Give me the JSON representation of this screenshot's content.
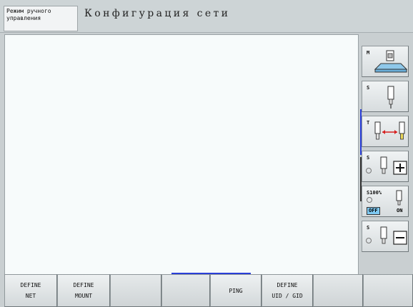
{
  "header": {
    "mode_label": "Режим ручного\nуправления",
    "title": "Конфигурация сети"
  },
  "side_softkeys": [
    {
      "label": "M",
      "icon": "machine-table-icon"
    },
    {
      "label": "S",
      "icon": "spindle-icon"
    },
    {
      "label": "T",
      "icon": "tool-change-icon"
    },
    {
      "label": "S",
      "icon": "spindle-plus-icon"
    },
    {
      "label": "S100%",
      "off": "OFF",
      "on": "ON",
      "icon": "spindle-override-icon"
    },
    {
      "label": "S",
      "icon": "spindle-minus-icon"
    }
  ],
  "softkeys": [
    {
      "line1": "DEFINE",
      "line2": "NET"
    },
    {
      "line1": "DEFINE",
      "line2": "MOUNT"
    },
    {
      "line1": "",
      "line2": ""
    },
    {
      "line1": "",
      "line2": ""
    },
    {
      "line1": "PING",
      "line2": ""
    },
    {
      "line1": "DEFINE",
      "line2": "UID / GID"
    },
    {
      "line1": "",
      "line2": ""
    },
    {
      "line1": "",
      "line2": ""
    }
  ],
  "colors": {
    "accent_blue": "#2b3fd8",
    "off_badge": "#7ec9f2"
  }
}
